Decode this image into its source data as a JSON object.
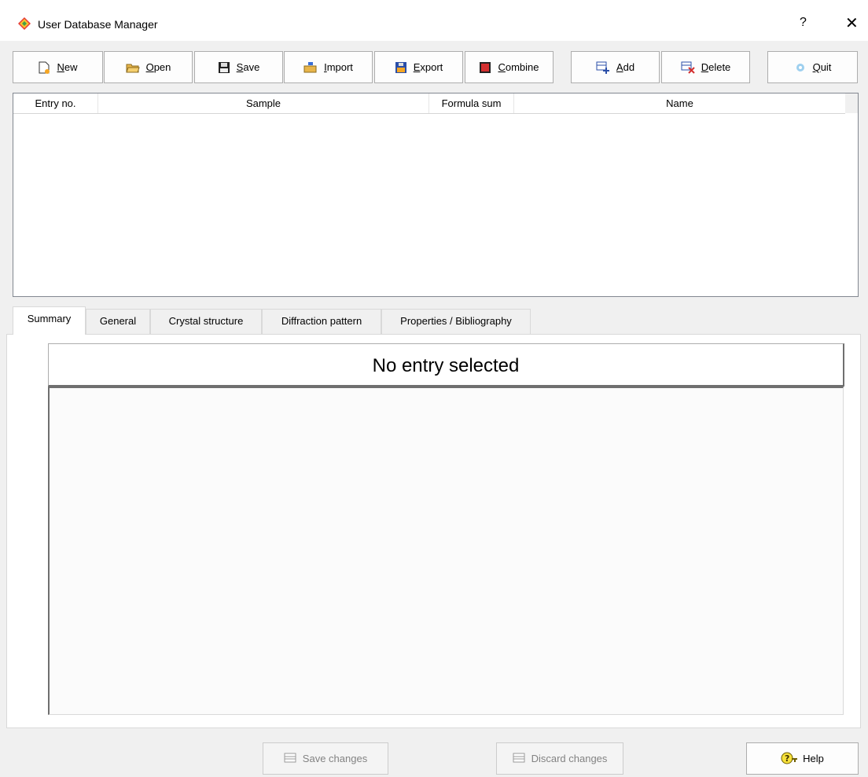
{
  "window": {
    "title": "User Database Manager",
    "help_glyph": "?",
    "close_glyph": "✕"
  },
  "toolbar": {
    "new": "New",
    "open": "Open",
    "save": "Save",
    "import": "Import",
    "export": "Export",
    "combine": "Combine",
    "add": "Add",
    "delete": "Delete",
    "quit": "Quit"
  },
  "table": {
    "columns": [
      "Entry no.",
      "Sample",
      "Formula sum",
      "Name"
    ],
    "rows": []
  },
  "tabs": [
    "Summary",
    "General",
    "Crystal structure",
    "Diffraction pattern",
    "Properties / Bibliography"
  ],
  "active_tab": "Summary",
  "summary": {
    "header_text": "No entry selected"
  },
  "footer": {
    "save_changes": "Save changes",
    "discard_changes": "Discard changes",
    "help": "Help"
  },
  "colors": {
    "window_bg": "#f0f0f0",
    "border": "#adadad",
    "disabled_text": "#838383"
  }
}
